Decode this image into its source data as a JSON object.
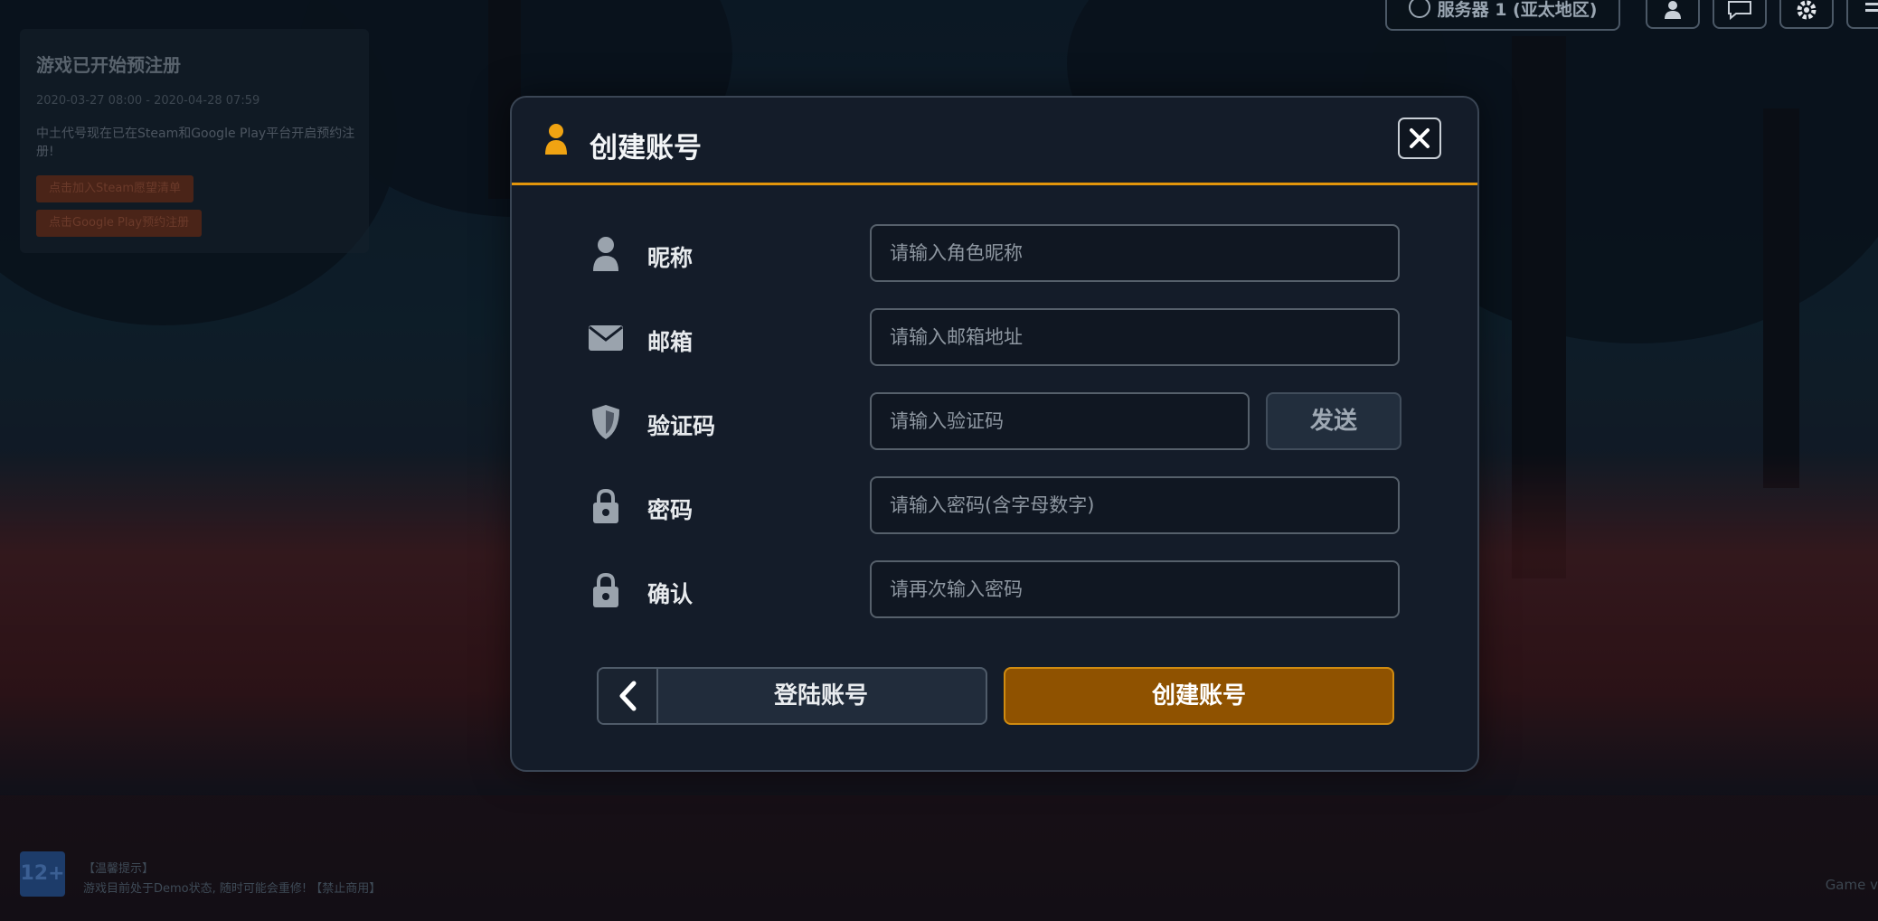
{
  "announcement": {
    "title": "游戏已开始预注册",
    "date": "2020-03-27 08:00 - 2020-04-28 07:59",
    "description": "中土代号现在已在Steam和Google Play平台开启预约注册!",
    "steam_button": "点击加入Steam愿望清单",
    "google_button": "点击Google Play预约注册"
  },
  "topbar": {
    "server_label": "服务器 1 (亚太地区)",
    "icons": [
      "account-icon",
      "chat-icon",
      "gear-icon",
      "menu-icon"
    ]
  },
  "modal": {
    "title": "创建账号",
    "fields": [
      {
        "label": "昵称",
        "placeholder": "请输入角色昵称",
        "icon": "user-icon",
        "value": ""
      },
      {
        "label": "邮箱",
        "placeholder": "请输入邮箱地址",
        "icon": "mail-icon",
        "value": ""
      },
      {
        "label": "验证码",
        "placeholder": "请输入验证码",
        "icon": "shield-icon",
        "value": ""
      },
      {
        "label": "密码",
        "placeholder": "请输入密码(含字母数字)",
        "icon": "lock-icon",
        "value": ""
      },
      {
        "label": "确认",
        "placeholder": "请再次输入密码",
        "icon": "lock-icon",
        "value": ""
      }
    ],
    "send_button": "发送",
    "back_button": "登陆账号",
    "create_button": "创建账号"
  },
  "footer": {
    "age_rating": "12+",
    "notice_title": "【温馨提示】",
    "notice_text": "游戏目前处于Demo状态, 随时可能会重修! 【禁止商用】",
    "game_version": "Game v"
  },
  "colors": {
    "accent": "#e2950b",
    "create_button_bg": "#8f5200",
    "modal_bg": "#141c29"
  }
}
